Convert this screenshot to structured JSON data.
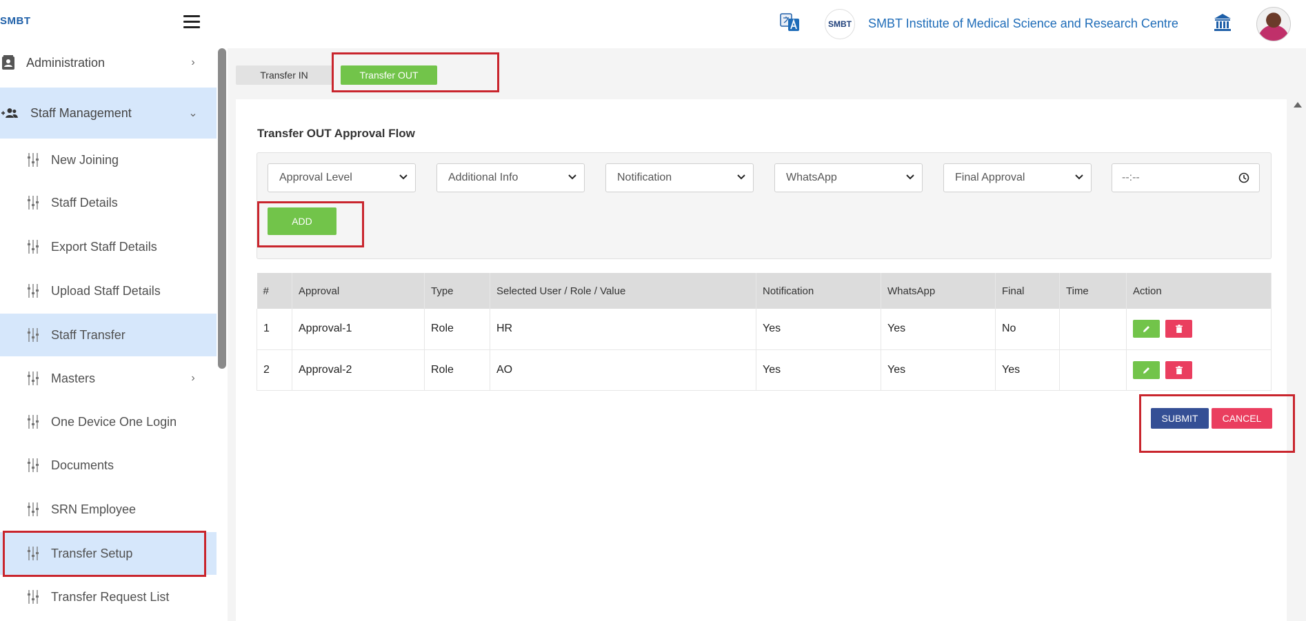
{
  "header": {
    "logo_text": "SMBT",
    "badge_text": "SMBT",
    "institute_name": "SMBT Institute of Medical Science and Research Centre"
  },
  "sidebar": {
    "administration": "Administration",
    "staff_management": "Staff Management",
    "items": [
      {
        "label": "New Joining"
      },
      {
        "label": "Staff Details"
      },
      {
        "label": "Export Staff Details"
      },
      {
        "label": "Upload Staff Details"
      },
      {
        "label": "Staff Transfer"
      },
      {
        "label": "Masters"
      },
      {
        "label": "One Device One Login"
      },
      {
        "label": "Documents"
      },
      {
        "label": "SRN Employee"
      },
      {
        "label": "Transfer Setup"
      },
      {
        "label": "Transfer Request List"
      }
    ]
  },
  "tabs": {
    "transfer_in": "Transfer IN",
    "transfer_out": "Transfer OUT"
  },
  "form": {
    "title": "Transfer OUT Approval Flow",
    "approval_level": "Approval Level",
    "additional_info": "Additional Info",
    "notification": "Notification",
    "whatsapp": "WhatsApp",
    "final_approval": "Final Approval",
    "time_placeholder": "--:--",
    "add_label": "ADD"
  },
  "table": {
    "headers": [
      "#",
      "Approval",
      "Type",
      "Selected User / Role / Value",
      "Notification",
      "WhatsApp",
      "Final",
      "Time",
      "Action"
    ],
    "rows": [
      {
        "num": "1",
        "approval": "Approval-1",
        "type": "Role",
        "value": "HR",
        "notification": "Yes",
        "whatsapp": "Yes",
        "final": "No",
        "time": ""
      },
      {
        "num": "2",
        "approval": "Approval-2",
        "type": "Role",
        "value": "AO",
        "notification": "Yes",
        "whatsapp": "Yes",
        "final": "Yes",
        "time": ""
      }
    ]
  },
  "actions": {
    "submit": "SUBMIT",
    "cancel": "CANCEL"
  },
  "colors": {
    "green": "#72c44a",
    "red": "#ea3e5f",
    "navy": "#344f95",
    "highlight": "#c9252d",
    "active_bg": "#d6e7fb"
  }
}
